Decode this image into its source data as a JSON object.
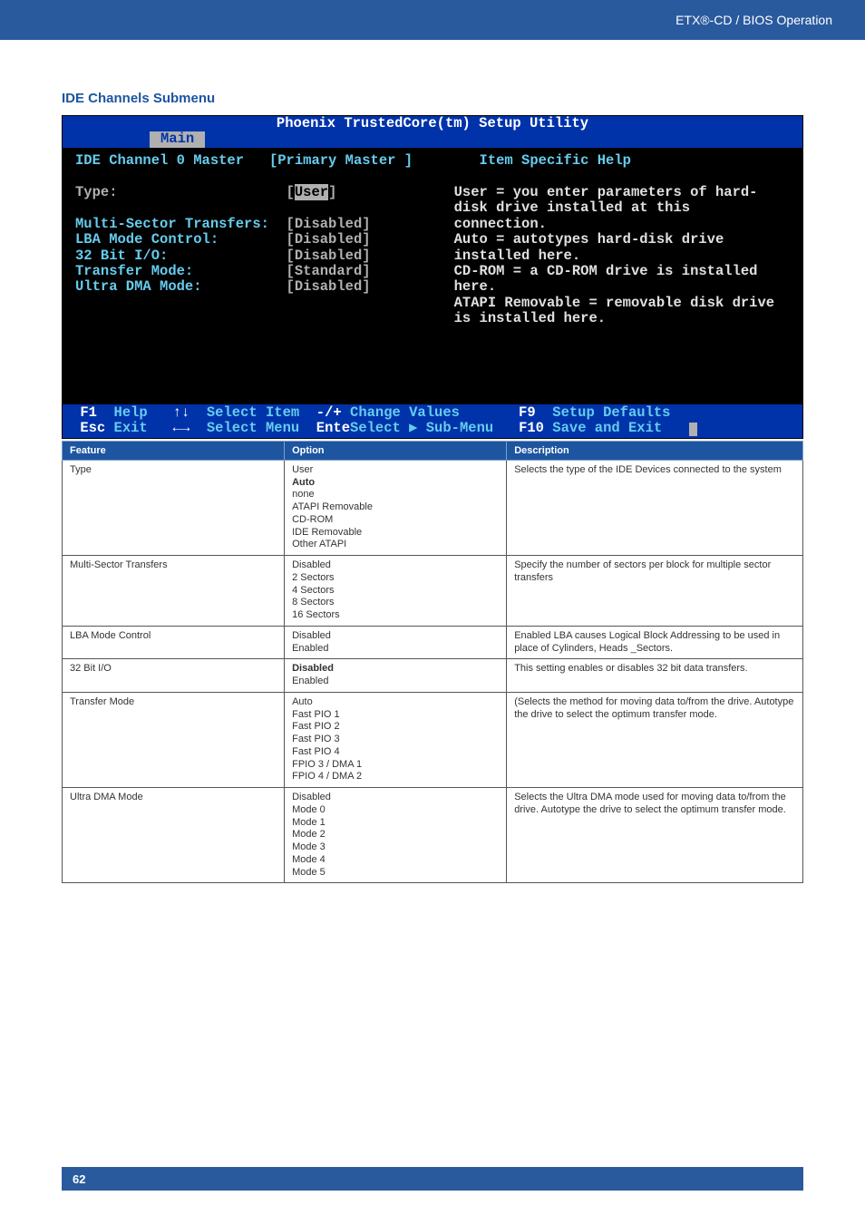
{
  "header": {
    "product": "ETX®-CD / BIOS Operation"
  },
  "section_title": "IDE Channels Submenu",
  "bios": {
    "title": "Phoenix TrustedCore(tm) Setup Utility",
    "active_tab": "Main",
    "header_row": {
      "left_label": "IDE Channel 0 Master",
      "left_value": "[Primary Master ]",
      "right_title": "Item Specific Help"
    },
    "fields": [
      {
        "label": "Type:",
        "value": "[User]",
        "highlight": true,
        "label_grey": true
      },
      {
        "label": "",
        "value": ""
      },
      {
        "label": "Multi-Sector Transfers:",
        "value": "[Disabled]"
      },
      {
        "label": "LBA Mode Control:",
        "value": "[Disabled]"
      },
      {
        "label": "32 Bit I/O:",
        "value": "[Disabled]"
      },
      {
        "label": "Transfer Mode:",
        "value": "[Standard]"
      },
      {
        "label": "Ultra DMA Mode:",
        "value": "[Disabled]"
      }
    ],
    "help_text": "User = you enter parameters of hard-disk drive installed at this connection.\nAuto = autotypes hard-disk drive installed here.\nCD-ROM = a CD-ROM drive is installed here.\nATAPI Removable = removable disk drive is installed here.",
    "footer": {
      "row1": [
        {
          "key": "F1",
          "label": "Help"
        },
        {
          "key": "↑↓",
          "label": "Select Item"
        },
        {
          "key": "-/+",
          "label": "Change Values"
        },
        {
          "key": "F9",
          "label": "Setup Defaults"
        }
      ],
      "row2": [
        {
          "key": "Esc",
          "label": "Exit"
        },
        {
          "key": "←→",
          "label": "Select Menu"
        },
        {
          "key": "Enter",
          "label": "Select ▶ Sub-Menu"
        },
        {
          "key": "F10",
          "label": "Save and Exit"
        }
      ]
    }
  },
  "table": {
    "headers": [
      "Feature",
      "Option",
      "Description"
    ],
    "rows": [
      {
        "feature": "Type",
        "options": [
          "User",
          "Auto",
          "none",
          "ATAPI Removable",
          "CD-ROM",
          "IDE Removable",
          "Other ATAPI"
        ],
        "bold_option": "Auto",
        "description": "Selects the type of the IDE Devices connected to the system"
      },
      {
        "feature": "Multi-Sector Transfers",
        "options": [
          "Disabled",
          "2 Sectors",
          "4 Sectors",
          "8 Sectors",
          "16 Sectors"
        ],
        "description": "Specify the number of sectors per block for multiple sector transfers"
      },
      {
        "feature": "LBA Mode Control",
        "options": [
          "Disabled",
          "Enabled"
        ],
        "description": "Enabled LBA causes Logical Block Addressing to be used in place of Cylinders, Heads _Sectors."
      },
      {
        "feature": "32 Bit I/O",
        "options": [
          "Disabled",
          "Enabled"
        ],
        "bold_option": "Disabled",
        "description": "This setting enables or disables 32 bit data transfers."
      },
      {
        "feature": "Transfer Mode",
        "options": [
          "Auto",
          "Fast PIO 1",
          "Fast PIO 2",
          "Fast PIO 3",
          "Fast PIO 4",
          "FPIO 3 / DMA 1",
          "FPIO 4 / DMA 2"
        ],
        "description": "(Selects the method for moving data to/from the drive. Autotype the drive to select the optimum transfer mode."
      },
      {
        "feature": "Ultra DMA Mode",
        "options": [
          "Disabled",
          "Mode 0",
          "Mode 1",
          "Mode 2",
          "Mode 3",
          "Mode 4",
          "Mode 5"
        ],
        "description": "Selects the Ultra DMA mode used for moving data to/from the drive. Autotype the drive to select the optimum transfer mode."
      }
    ]
  },
  "page_number": "62"
}
